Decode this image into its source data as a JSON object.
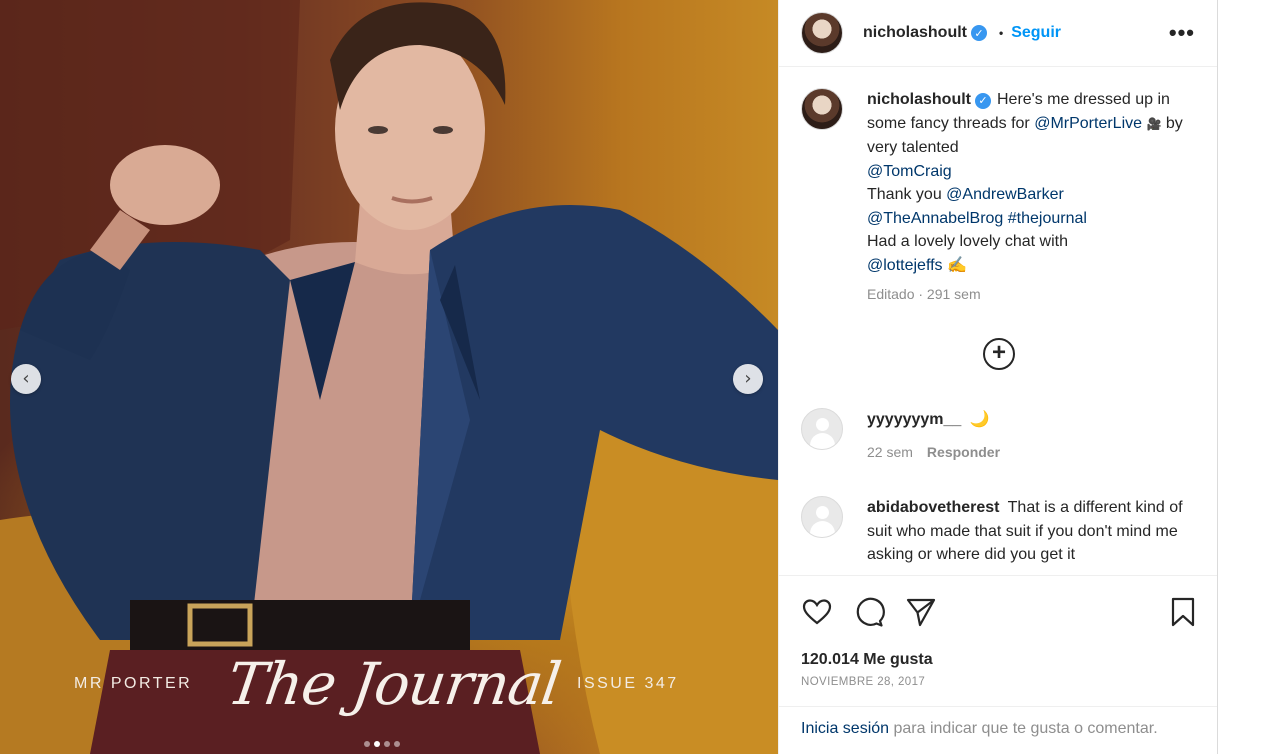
{
  "post": {
    "username": "nicholashoult",
    "verified_icon": "verified-badge-icon",
    "follow_label": "Seguir",
    "more_label": "•••",
    "separator": "•"
  },
  "media": {
    "prev_label": "‹",
    "next_label": "›",
    "magazine_brand": "MR PORTER",
    "magazine_title": "The Journal",
    "magazine_issue": "ISSUE 347",
    "slide_count": 4,
    "active_slide": 2
  },
  "caption": {
    "username": "nicholashoult",
    "line1": "Here's me dressed up in some fancy threads for",
    "mention1": "@MrPorterLive",
    "emoji1": "🎥",
    "line2": "by very talented",
    "mention2": "@TomCraig",
    "line3": "Thank you",
    "mention3": "@AndrewBarker",
    "mention4": "@TheAnnabelBrog",
    "hashtag1": "#thejournal",
    "line4": "Had a lovely lovely chat with",
    "mention5": "@lottejeffs",
    "emoji2": "✍",
    "meta": "Editado · 291 sem"
  },
  "load_more_label": "+",
  "comments": [
    {
      "username": "yyyyyyym__",
      "text": "🌙",
      "age": "22 sem",
      "reply_label": "Responder"
    },
    {
      "username": "abidabovetherest",
      "text": "That is a different kind of suit who made that suit if you don't mind me asking or where did you get it"
    }
  ],
  "actions": {
    "like_icon": "heart-icon",
    "comment_icon": "comment-icon",
    "share_icon": "send-icon",
    "save_icon": "bookmark-icon"
  },
  "likes_text": "120.014 Me gusta",
  "date_text": "Noviembre 28, 2017",
  "login": {
    "link": "Inicia sesión",
    "rest": "para indicar que te gusta o comentar."
  },
  "colors": {
    "accent": "#0095f6",
    "mention": "#00376b",
    "muted": "#8e8e8e",
    "verified": "#3897f0"
  }
}
